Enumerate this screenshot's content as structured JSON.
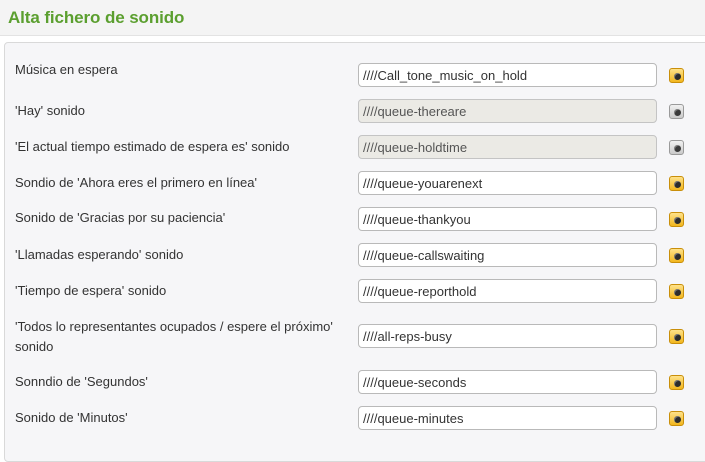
{
  "header": {
    "title": "Alta fichero de sonido"
  },
  "rows": [
    {
      "label": "Música en espera",
      "value": "////Call_tone_music_on_hold",
      "disabled": false,
      "icon": "speaker-icon"
    },
    {
      "label": "'Hay' sonido",
      "value": "////queue-thereare",
      "disabled": true,
      "icon": "speaker-icon"
    },
    {
      "label": "'El actual tiempo estimado de espera es' sonido",
      "value": "////queue-holdtime",
      "disabled": true,
      "icon": "speaker-icon"
    },
    {
      "label": "Sondio de 'Ahora eres el primero en línea'",
      "value": "////queue-youarenext",
      "disabled": false,
      "icon": "speaker-icon"
    },
    {
      "label": "Sonido de 'Gracias por su paciencia'",
      "value": "////queue-thankyou",
      "disabled": false,
      "icon": "speaker-icon"
    },
    {
      "label": "'Llamadas esperando' sonido",
      "value": "////queue-callswaiting",
      "disabled": false,
      "icon": "speaker-icon"
    },
    {
      "label": "'Tiempo de espera' sonido",
      "value": "////queue-reporthold",
      "disabled": false,
      "icon": "speaker-icon"
    },
    {
      "label": "'Todos lo representantes ocupados / espere el próximo' sonido",
      "value": "////all-reps-busy",
      "disabled": false,
      "icon": "speaker-icon"
    },
    {
      "label": "Sonndio de 'Segundos'",
      "value": "////queue-seconds",
      "disabled": false,
      "icon": "speaker-icon"
    },
    {
      "label": "Sonido de 'Minutos'",
      "value": "////queue-minutes",
      "disabled": false,
      "icon": "speaker-icon"
    }
  ]
}
